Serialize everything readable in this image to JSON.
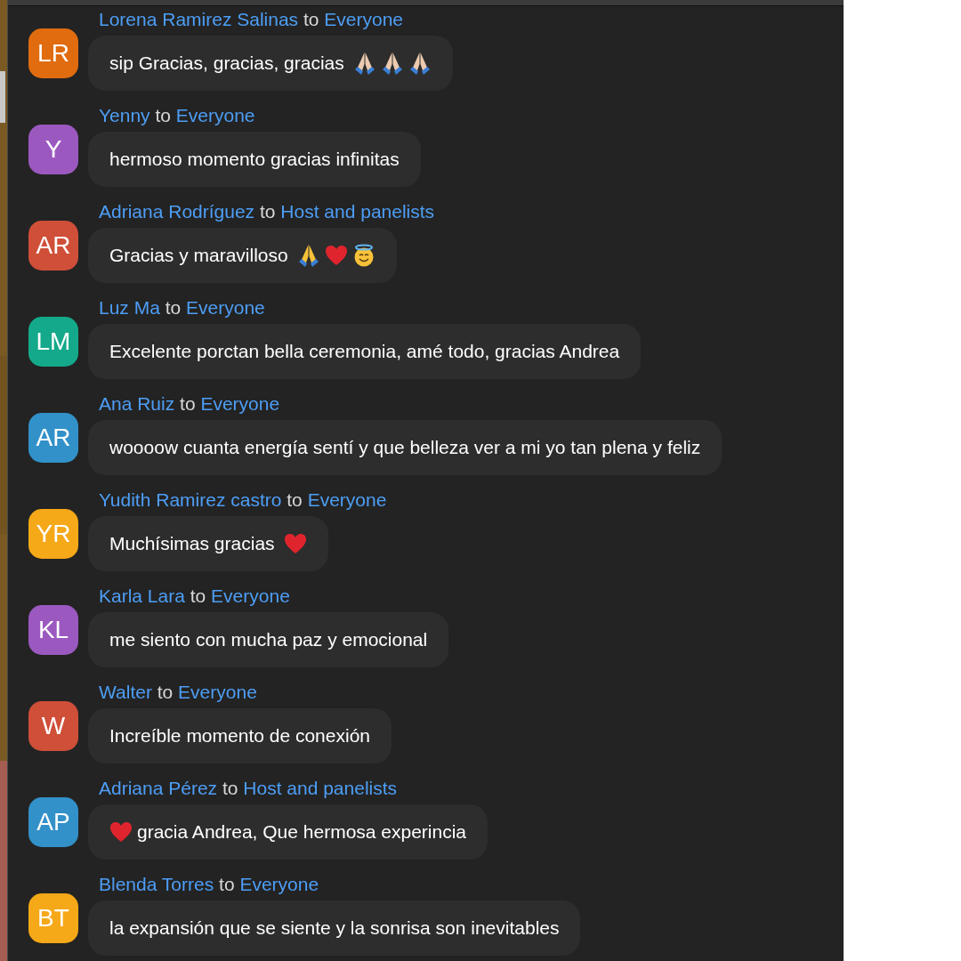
{
  "messages": [
    {
      "sender": "Lorena Ramirez Salinas",
      "to": "to",
      "recipient": "Everyone",
      "initials": "LR",
      "color": "#e06c0f",
      "parts": [
        {
          "kind": "text",
          "text": "sip Gracias, gracias, gracias"
        },
        {
          "kind": "praying-hands",
          "color": "#eccbb0"
        },
        {
          "kind": "praying-hands",
          "color": "#eccbb0"
        },
        {
          "kind": "praying-hands",
          "color": "#eccbb0"
        }
      ]
    },
    {
      "sender": "Yenny",
      "to": "to",
      "recipient": "Everyone",
      "initials": "Y",
      "color": "#9b59c0",
      "parts": [
        {
          "kind": "text",
          "text": "hermoso momento gracias infinitas"
        }
      ]
    },
    {
      "sender": "Adriana Rodríguez",
      "to": "to",
      "recipient": "Host and panelists",
      "initials": "AR",
      "color": "#cf4f38",
      "parts": [
        {
          "kind": "text",
          "text": "Gracias y maravilloso"
        },
        {
          "kind": "praying-hands",
          "color": "#f7c23a"
        },
        {
          "kind": "heart"
        },
        {
          "kind": "halo-face"
        }
      ]
    },
    {
      "sender": "Luz Ma",
      "to": "to",
      "recipient": "Everyone",
      "initials": "LM",
      "color": "#14a98b",
      "parts": [
        {
          "kind": "text",
          "text": "Excelente porctan bella ceremonia, amé todo, gracias Andrea"
        }
      ]
    },
    {
      "sender": "Ana Ruiz",
      "to": "to",
      "recipient": "Everyone",
      "initials": "AR",
      "color": "#3291c9",
      "parts": [
        {
          "kind": "text",
          "text": "woooow cuanta energía sentí y que belleza ver a mi yo tan plena y feliz"
        }
      ]
    },
    {
      "sender": "Yudith Ramirez castro",
      "to": "to",
      "recipient": "Everyone",
      "initials": "YR",
      "color": "#f5a818",
      "parts": [
        {
          "kind": "text",
          "text": "Muchísimas gracias"
        },
        {
          "kind": "heart"
        }
      ]
    },
    {
      "sender": "Karla Lara",
      "to": "to",
      "recipient": "Everyone",
      "initials": "KL",
      "color": "#9b59c0",
      "parts": [
        {
          "kind": "text",
          "text": "me siento con mucha paz y emocional"
        }
      ]
    },
    {
      "sender": "Walter",
      "to": "to",
      "recipient": "Everyone",
      "initials": "W",
      "color": "#cf4f38",
      "parts": [
        {
          "kind": "text",
          "text": "Increíble momento de conexión"
        }
      ]
    },
    {
      "sender": "Adriana Pérez",
      "to": "to",
      "recipient": "Host and panelists",
      "initials": "AP",
      "color": "#3291c9",
      "parts": [
        {
          "kind": "heart"
        },
        {
          "kind": "text",
          "text": "gracia Andrea, Que hermosa experincia"
        }
      ]
    },
    {
      "sender": "Blenda Torres",
      "to": "to",
      "recipient": "Everyone",
      "initials": "BT",
      "color": "#f5a818",
      "parts": [
        {
          "kind": "text",
          "text": "la expansión que se siente y la sonrisa son inevitables"
        }
      ]
    }
  ]
}
